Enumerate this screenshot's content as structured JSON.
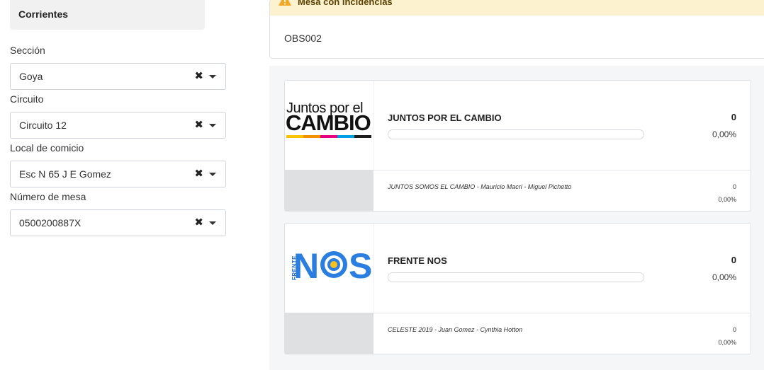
{
  "filters": {
    "province": "Corrientes",
    "seccion": {
      "label": "Sección",
      "value": "Goya"
    },
    "circuito": {
      "label": "Circuito",
      "value": "Circuito 12"
    },
    "local": {
      "label": "Local de comicio",
      "value": "Esc N 65 J E Gomez"
    },
    "mesa": {
      "label": "Número de mesa",
      "value": "0500200887X"
    },
    "clear_glyph": "✖"
  },
  "incident": {
    "title": "Mesa con incidencias",
    "code": "OBS002",
    "icon": "warning-icon",
    "color": "#f5a623"
  },
  "parties": [
    {
      "name": "JUNTOS POR EL CAMBIO",
      "votes": "0",
      "percent": "0,00%",
      "progress_fraction": 0,
      "logo": {
        "line1": "Juntos por el",
        "line2": "CAMBIO",
        "stripe_colors": [
          "#f6c500",
          "#f39200",
          "#e6007e",
          "#009fe3",
          "#1d1d1b"
        ]
      },
      "list": {
        "name": "JUNTOS SOMOS EL CAMBIO - Mauricio Macri - Miguel Pichetto",
        "votes": "0",
        "percent": "0,00%"
      }
    },
    {
      "name": "FRENTE NOS",
      "votes": "0",
      "percent": "0,00%",
      "progress_fraction": 0,
      "logo": {
        "small": "FRENTE",
        "n": "N",
        "s": "S",
        "blue": "#2a7de1",
        "yellow": "#f7c21b"
      },
      "list": {
        "name": "CELESTE 2019 - Juan Gomez - Cynthia Hotton",
        "votes": "0",
        "percent": "0,00%"
      }
    }
  ]
}
